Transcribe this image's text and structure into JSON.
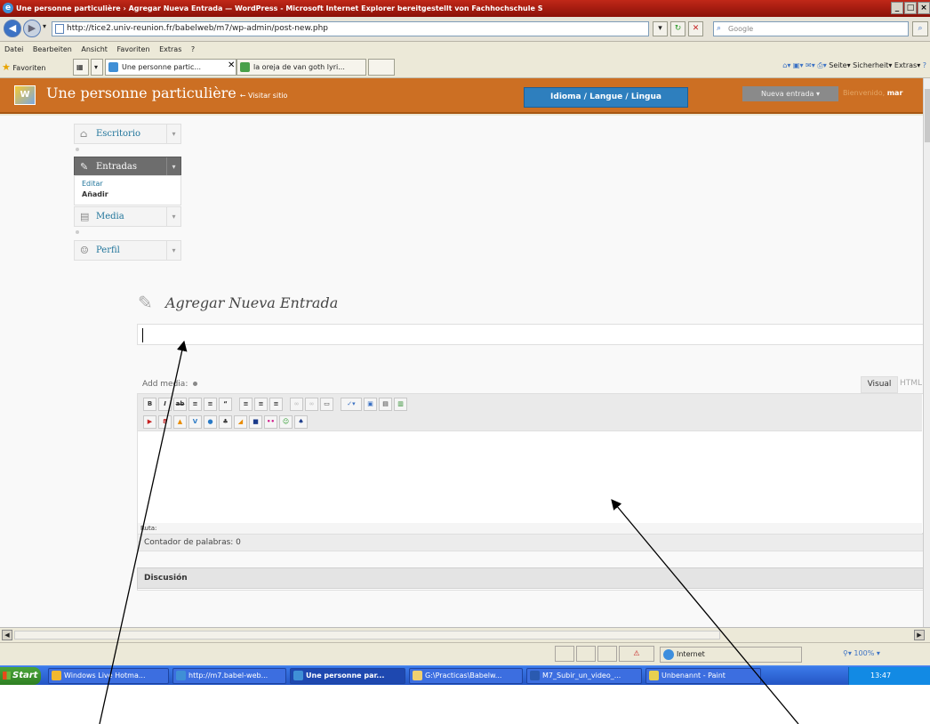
{
  "window": {
    "title": "Une personne particulière › Agregar Nueva Entrada — WordPress - Microsoft Internet Explorer bereitgestellt von Fachhochschule S",
    "buttons": [
      "_",
      "□",
      "×"
    ]
  },
  "addressbar": {
    "url": "http://tice2.univ-reunion.fr/babelweb/m7/wp-admin/post-new.php",
    "search_placeholder": "Google"
  },
  "menubar": [
    "Datei",
    "Bearbeiten",
    "Ansicht",
    "Favoriten",
    "Extras",
    "?"
  ],
  "favbar": {
    "favorites_label": "Favoriten",
    "tabs": [
      {
        "label": "Une personne partic...",
        "active": true
      },
      {
        "label": "la oreja de van goth lyri...",
        "active": false
      }
    ],
    "commands": [
      "Seite",
      "Sicherheit",
      "Extras"
    ]
  },
  "wp": {
    "site_title": "Une personne particulière",
    "visit_link": "← Visitar sitio",
    "language_button": "Idioma / Langue / Lingua",
    "new_entry_button": "Nueva entrada",
    "greeting": "Bienvenido,",
    "user": "mar"
  },
  "sidebar": {
    "items": [
      {
        "label": "Escritorio"
      },
      {
        "label": "Entradas"
      },
      {
        "label": "Media"
      },
      {
        "label": "Perfil"
      }
    ],
    "submenu": [
      "Editar",
      "Añadir"
    ]
  },
  "editor": {
    "page_title": "Agregar Nueva Entrada",
    "add_media": "Add media:",
    "visual_tab": "Visual",
    "html_tab": "HTML",
    "path_label": "Ruta:",
    "word_count": "Contador de palabras: 0",
    "discussion": "Discusión"
  },
  "statusbar": {
    "zone": "Internet",
    "zoom": "100%"
  },
  "taskbar": {
    "start": "Start",
    "tasks": [
      "Windows Live Hotma...",
      "http://m7.babel-web...",
      "Une personne par...",
      "G:\\Practicas\\Babelw...",
      "M7_Subir_un_video_...",
      "Unbenannt - Paint"
    ],
    "clock": "13:47"
  }
}
